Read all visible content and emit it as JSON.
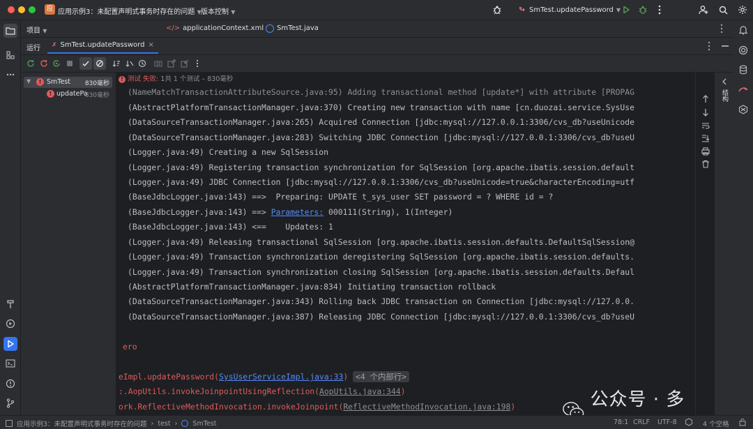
{
  "titlebar": {
    "project_badge": "应",
    "project_name": "应用示例3：未配置声明式事务时存在的问题",
    "vcs": "版本控制",
    "run_config": "SmTest.updatePassword"
  },
  "editor_tabs": [
    {
      "label": "applicationContext.xml"
    },
    {
      "label": "SmTest.java"
    }
  ],
  "project_panel": {
    "label": "项目"
  },
  "run_panel": {
    "label": "运行",
    "tab": "SmTest.updatePassword"
  },
  "status": {
    "text": "测试 失败: ",
    "count": "1共 1 个测试 – 830毫秒"
  },
  "tree": {
    "root": {
      "label": "SmTest",
      "time": "830毫秒"
    },
    "child": {
      "label": "updatePa",
      "time": "830毫秒"
    }
  },
  "log_lines": [
    "(NameMatchTransactionAttributeSource.java:95) Adding transactional method [update*] with attribute [PROPAG",
    "(AbstractPlatformTransactionManager.java:370) Creating new transaction with name [cn.duozai.service.SysUse",
    "(DataSourceTransactionManager.java:265) Acquired Connection [jdbc:mysql://127.0.0.1:3306/cvs_db?useUnicode",
    "(DataSourceTransactionManager.java:283) Switching JDBC Connection [jdbc:mysql://127.0.0.1:3306/cvs_db?useU",
    "(Logger.java:49) Creating a new SqlSession",
    "(Logger.java:49) Registering transaction synchronization for SqlSession [org.apache.ibatis.session.default",
    "(Logger.java:49) JDBC Connection [jdbc:mysql://127.0.0.1:3306/cvs_db?useUnicode=true&characterEncoding=utf",
    "(BaseJdbcLogger.java:143) ==>  Preparing: UPDATE t_sys_user SET password = ? WHERE id = ?"
  ],
  "param_line": {
    "prefix": "(BaseJdbcLogger.java:143) ==> ",
    "link": "Parameters:",
    "suffix": " 000111(String), 1(Integer)"
  },
  "log_lines_b": [
    "(BaseJdbcLogger.java:143) <==    Updates: 1",
    "(Logger.java:49) Releasing transactional SqlSession [org.apache.ibatis.session.defaults.DefaultSqlSession@",
    "(Logger.java:49) Transaction synchronization deregistering SqlSession [org.apache.ibatis.session.defaults.",
    "(Logger.java:49) Transaction synchronization closing SqlSession [org.apache.ibatis.session.defaults.Defaul",
    "(AbstractPlatformTransactionManager.java:834) Initiating transaction rollback",
    "(DataSourceTransactionManager.java:343) Rolling back JDBC transaction on Connection [jdbc:mysql://127.0.0.",
    "(DataSourceTransactionManager.java:387) Releasing JDBC Connection [jdbc:mysql://127.0.0.1:3306/cvs_db?useU"
  ],
  "error": {
    "zero_line": "ero",
    "trace1_prefix": "eImpl.updatePassword(",
    "trace1_link": "SysUserServiceImpl.java:33",
    "trace1_suffix": ")",
    "trace1_badge": "<4 个内部行>",
    "trace2_prefix": ":.AopUtils.invokeJoinpointUsingReflection(",
    "trace2_link": "AopUtils.java:344",
    "trace2_suffix": ")",
    "trace3_prefix": "ork.ReflectiveMethodInvocation.invokeJoinpoint(",
    "trace3_link": "ReflectiveMethodInvocation.java:198",
    "trace3_suffix": ")"
  },
  "watermark": {
    "text": "公众号 · 多仔"
  },
  "side_label": "结构",
  "statusbar": {
    "crumb1": "应用示例3：未配置声明式事务时存在的问题",
    "crumb2": "test",
    "crumb3": "SmTest",
    "position": "78:1",
    "line_sep": "CRLF",
    "encoding": "UTF-8",
    "indent": "4 个空格"
  },
  "colors": {
    "accent": "#3574f0",
    "error": "#db5c5c",
    "link": "#548af7",
    "run_green": "#57965c"
  }
}
